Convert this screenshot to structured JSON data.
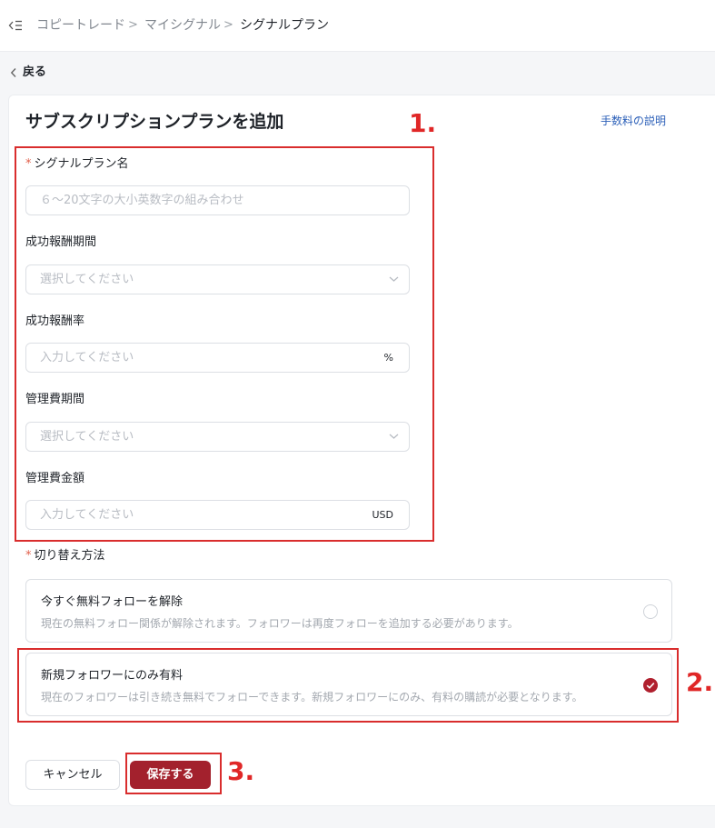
{
  "breadcrumb": {
    "items": [
      "コピートレード",
      "マイシグナル",
      "シグナルプラン"
    ],
    "separator": ">"
  },
  "back": {
    "label": "戻る"
  },
  "page": {
    "title": "サブスクリプションプランを追加",
    "fee_link": "手数料の説明"
  },
  "form": {
    "plan_name": {
      "required_mark": "*",
      "label": "シグナルプラン名",
      "placeholder": "６～20文字の大小英数字の組み合わせ"
    },
    "perf_period": {
      "label": "成功報酬期間",
      "placeholder": "選択してください"
    },
    "perf_rate": {
      "label": "成功報酬率",
      "placeholder": "入力してください",
      "suffix": "%"
    },
    "mgmt_period": {
      "label": "管理費期間",
      "placeholder": "選択してください"
    },
    "mgmt_amount": {
      "label": "管理費金額",
      "placeholder": "入力してください",
      "suffix": "USD"
    }
  },
  "switch_method": {
    "required_mark": "*",
    "label": "切り替え方法",
    "options": [
      {
        "title": "今すぐ無料フォローを解除",
        "description": "現在の無料フォロー関係が解除されます。フォロワーは再度フォローを追加する必要があります。",
        "selected": false
      },
      {
        "title": "新規フォロワーにのみ有料",
        "description": "現在のフォロワーは引き続き無料でフォローできます。新規フォロワーにのみ、有料の購読が必要となります。",
        "selected": true
      }
    ]
  },
  "buttons": {
    "cancel": "キャンセル",
    "save": "保存する"
  },
  "annotations": [
    "1.",
    "2.",
    "3."
  ],
  "colors": {
    "accent": "#a3212d",
    "annotation": "#e02727",
    "link": "#2b5fb8",
    "required": "#e15f4a"
  },
  "icons": {
    "collapse": "menu-collapse-icon",
    "back": "chevron-left-icon",
    "select": "chevron-down-icon",
    "check": "check-icon"
  }
}
